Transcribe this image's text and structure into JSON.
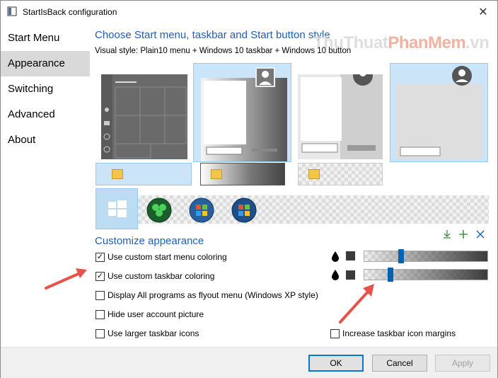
{
  "window": {
    "title": "StartIsBack configuration",
    "close_glyph": "✕"
  },
  "sidebar": {
    "items": [
      {
        "label": "Start Menu"
      },
      {
        "label": "Appearance"
      },
      {
        "label": "Switching"
      },
      {
        "label": "Advanced"
      },
      {
        "label": "About"
      }
    ],
    "active_index": 1
  },
  "main": {
    "heading": "Choose Start menu, taskbar and Start button style",
    "watermark": {
      "part1": "ThuThuat",
      "part2": "PhanMem",
      "part3": ".vn"
    },
    "visual_style": "Visual style:  Plain10 menu + Windows 10 taskbar + Windows 10 button",
    "customize_heading": "Customize appearance",
    "toolbar_icons": [
      "download-icon",
      "plus-icon",
      "close-icon"
    ],
    "options": [
      {
        "label": "Use custom start menu coloring",
        "checked": true
      },
      {
        "label": "Use custom taskbar coloring",
        "checked": true
      },
      {
        "label": "Display All programs as flyout menu (Windows XP style)",
        "checked": false
      },
      {
        "label": "Hide user account picture",
        "checked": false
      },
      {
        "label": "Use larger taskbar icons",
        "checked": false
      },
      {
        "label": "Increase taskbar icon margins",
        "checked": false
      }
    ],
    "sliders": [
      {
        "name": "start-menu-opacity",
        "value": 0.29
      },
      {
        "name": "taskbar-opacity",
        "value": 0.2
      }
    ],
    "check_glyph": "✓"
  },
  "footer": {
    "ok_label": "OK",
    "cancel_label": "Cancel",
    "apply_label": "Apply"
  },
  "colors": {
    "accent": "#0078d7",
    "heading": "#1e5fb4",
    "arrow": "#e5534b"
  }
}
